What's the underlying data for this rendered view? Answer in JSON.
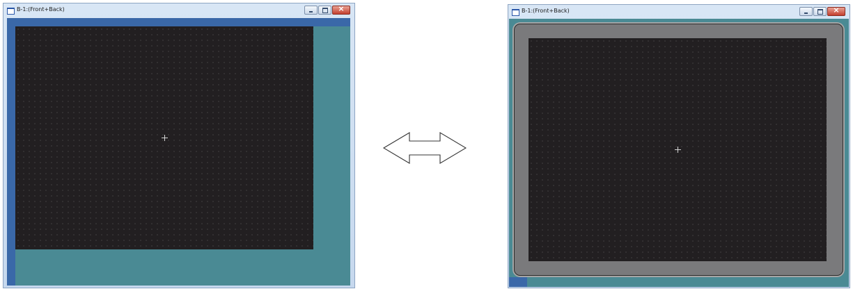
{
  "windows": {
    "left": {
      "title": "B-1:(Front+Back)"
    },
    "right": {
      "title": "B-1:(Front+Back)"
    }
  },
  "icons": {
    "window_icon": "window-icon",
    "minimize": "minimize-icon",
    "maximize": "maximize-icon",
    "close": "close-icon",
    "center_mark": "crosshair-icon",
    "arrow": "double-arrow-icon"
  },
  "colors": {
    "canvas_background": "#221f21",
    "grid_dots": "#5c5c5c",
    "workspace_teal": "#4a8a94",
    "workspace_blue": "#3a68a8",
    "device_bezel": "#7a7a7c",
    "close_button_red": "#c4402f"
  }
}
